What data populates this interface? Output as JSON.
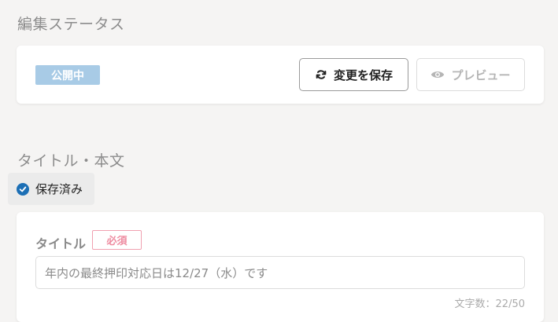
{
  "edit_status": {
    "section_title": "編集ステータス",
    "status_badge": "公開中",
    "save_button": {
      "label": "変更を保存",
      "icon": "refresh-icon"
    },
    "preview_button": {
      "label": "プレビュー",
      "icon": "eye-icon"
    }
  },
  "title_body": {
    "section_title": "タイトル・本文",
    "saved_indicator": {
      "label": "保存済み",
      "icon": "check-circle-icon"
    },
    "title_field": {
      "label": "タイトル",
      "required_badge": "必須",
      "value": "年内の最終押印対応日は12/27（水）です",
      "char_count": "文字数：22/50"
    }
  },
  "colors": {
    "background": "#f5f4f3",
    "status_badge_bg": "#a8cbe6",
    "check_blue": "#1c6fb5",
    "required_pink": "#ee8ba0"
  }
}
